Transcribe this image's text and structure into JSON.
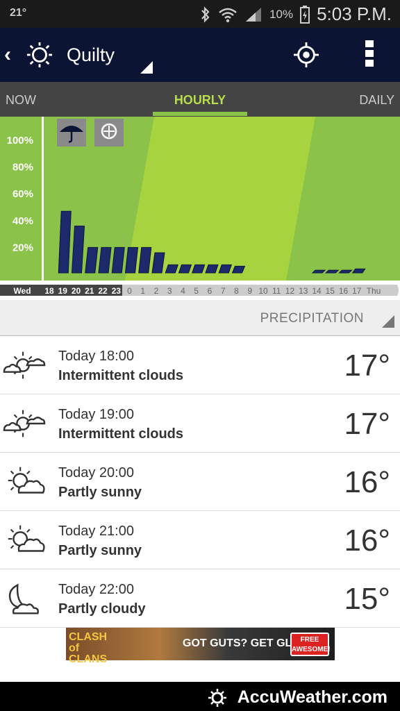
{
  "status": {
    "temp": "21°",
    "battery": "10%",
    "time": "5:03 P.M."
  },
  "appbar": {
    "city": "Quilty"
  },
  "tabs": {
    "now": "NOW",
    "hourly": "HOURLY",
    "daily": "DAILY"
  },
  "chart_data": {
    "type": "bar",
    "yticks": [
      "100%",
      "80%",
      "60%",
      "40%",
      "20%"
    ],
    "ylim": [
      0,
      100
    ],
    "day_start": "Wed",
    "day_end": "Thu",
    "categories": [
      "18",
      "19",
      "20",
      "21",
      "22",
      "23",
      "0",
      "1",
      "2",
      "3",
      "4",
      "5",
      "6",
      "7",
      "8",
      "9",
      "10",
      "11",
      "12",
      "13",
      "14",
      "15",
      "16",
      "17"
    ],
    "values": [
      0,
      46,
      35,
      19,
      19,
      19,
      19,
      19,
      15,
      6,
      6,
      6,
      6,
      6,
      5,
      0,
      0,
      0,
      0,
      0,
      2,
      2,
      2,
      3
    ],
    "series": [
      {
        "values": [
          0,
          46,
          35,
          19,
          19,
          19,
          19,
          19,
          15,
          6,
          6,
          6,
          6,
          6,
          5,
          0,
          0,
          0,
          0,
          0,
          2,
          2,
          2,
          3
        ]
      }
    ],
    "colors": {
      "bg": "#8bc34a",
      "band": "#a6d33e",
      "bar": "#1c2a6b"
    }
  },
  "section": {
    "label": "PRECIPITATION"
  },
  "hours": [
    {
      "when": "Today 18:00",
      "cond": "Intermittent clouds",
      "temp": "17°",
      "icon": "sun-cloud-icon"
    },
    {
      "when": "Today 19:00",
      "cond": "Intermittent clouds",
      "temp": "17°",
      "icon": "sun-cloud-icon"
    },
    {
      "when": "Today 20:00",
      "cond": "Partly sunny",
      "temp": "16°",
      "icon": "partly-sunny-icon"
    },
    {
      "when": "Today 21:00",
      "cond": "Partly sunny",
      "temp": "16°",
      "icon": "partly-sunny-icon"
    },
    {
      "when": "Today 22:00",
      "cond": "Partly cloudy",
      "temp": "15°",
      "icon": "moon-cloud-icon"
    }
  ],
  "ad": {
    "logo": "CLASH of CLANS",
    "text": "GOT GUTS? GET GLORY!",
    "button": "FREE AWESOME!"
  },
  "footer": {
    "brand": "AccuWeather.com"
  }
}
